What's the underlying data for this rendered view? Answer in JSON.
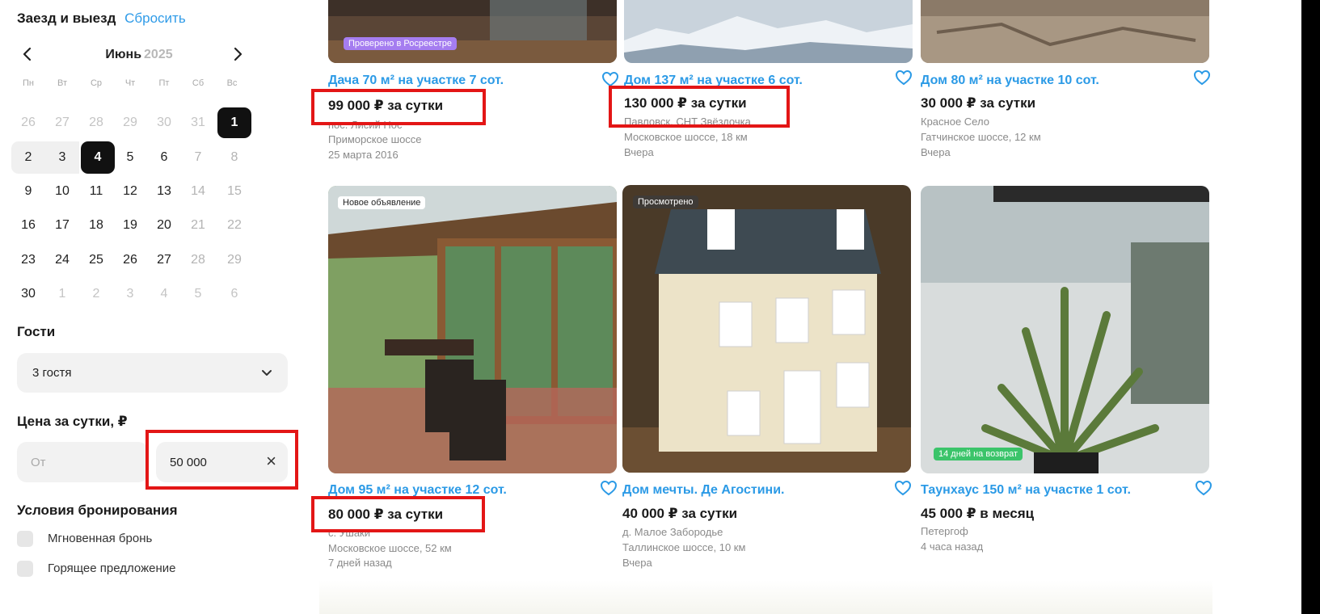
{
  "filters": {
    "dates_title": "Заезд и выезд",
    "reset_label": "Сбросить",
    "calendar": {
      "prev_label": "‹",
      "next_label": "›",
      "month": "Июнь",
      "year": "2025",
      "weekdays": [
        "Пн",
        "Вт",
        "Ср",
        "Чт",
        "Пт",
        "Сб",
        "Вс"
      ],
      "weeks": [
        [
          "26",
          "27",
          "28",
          "29",
          "30",
          "31",
          "1"
        ],
        [
          "2",
          "3",
          "4",
          "5",
          "6",
          "7",
          "8"
        ],
        [
          "9",
          "10",
          "11",
          "12",
          "13",
          "14",
          "15"
        ],
        [
          "16",
          "17",
          "18",
          "19",
          "20",
          "21",
          "22"
        ],
        [
          "23",
          "24",
          "25",
          "26",
          "27",
          "28",
          "29"
        ],
        [
          "30",
          "1",
          "2",
          "3",
          "4",
          "5",
          "6"
        ]
      ],
      "selected_days": [
        "1",
        "4"
      ]
    },
    "guests_title": "Гости",
    "guests_value": "3 гостя",
    "price_title": "Цена за сутки, ₽",
    "price_from_placeholder": "От",
    "price_to_value": "50 000",
    "clear_icon": "×",
    "conditions_title": "Условия бронирования",
    "conditions": [
      "Мгновенная бронь",
      "Горящее предложение"
    ]
  },
  "listings": [
    {
      "badge": "Проверено в Росреестре",
      "title": "Дача 70 м² на участке 7 сот.",
      "price": "99 000 ₽ за сутки",
      "location": "пос. Лисий Нос",
      "road": "Приморское шоссе",
      "date": "25 марта 2016"
    },
    {
      "badge": "",
      "title": "Дом 137 м² на участке 6 сот.",
      "price": "130 000 ₽ за сутки",
      "location": "Павловск, СНТ Звёздочка",
      "road": "Московское шоссе, 18 км",
      "date": "Вчера"
    },
    {
      "badge": "",
      "title": "Дом 80 м² на участке 10 сот.",
      "price": "30 000 ₽ за сутки",
      "location": "Красное Село",
      "road": "Гатчинское шоссе, 12 км",
      "date": "Вчера"
    },
    {
      "badge": "Новое объявление",
      "title": "Дом 95 м² на участке 12 сот.",
      "price": "80 000 ₽ за сутки",
      "location": "с. Ушаки",
      "road": "Московское шоссе, 52 км",
      "date": "7 дней назад"
    },
    {
      "badge": "Просмотрено",
      "title": "Дом мечты. Де Агостини.",
      "price": "40 000 ₽ за сутки",
      "location": "д. Малое Забородье",
      "road": "Таллинское шоссе, 10 км",
      "date": "Вчера"
    },
    {
      "badge": "14 дней на возврат",
      "title": "Таунхаус 150 м² на участке 1 сот.",
      "price": "45 000 ₽ в месяц",
      "location": "Петергоф",
      "road": "",
      "date": "4 часа назад"
    }
  ],
  "colors": {
    "accent": "#2b9ae6",
    "highlight": "#e31616",
    "selected_day": "#111111"
  }
}
